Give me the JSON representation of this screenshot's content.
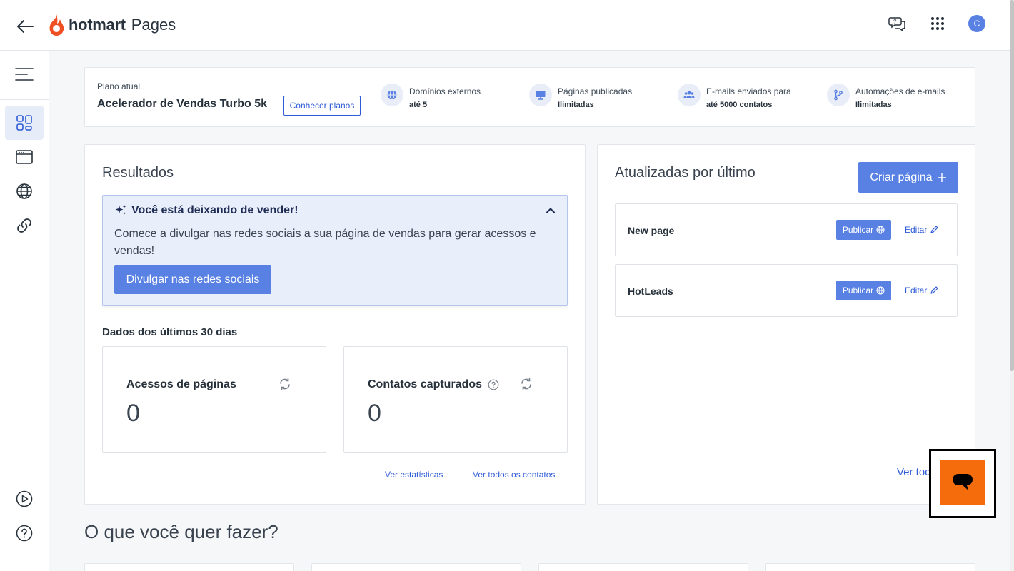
{
  "header": {
    "brand": "hotmart",
    "product": "Pages",
    "avatar_initial": "C",
    "icons": [
      "back-arrow-icon",
      "chat-help-icon",
      "apps-grid-icon"
    ]
  },
  "sidebar": {
    "items": [
      {
        "name": "dashboard",
        "icon": "dashboard-grid-icon",
        "active": true
      },
      {
        "name": "pages",
        "icon": "browser-window-icon",
        "active": false
      },
      {
        "name": "domains",
        "icon": "globe-icon",
        "active": false
      },
      {
        "name": "links",
        "icon": "link-icon",
        "active": false
      }
    ],
    "bottom": [
      "play-circle-icon",
      "help-circle-icon"
    ]
  },
  "plan": {
    "label": "Plano atual",
    "name": "Acelerador de Vendas Turbo 5k",
    "button": "Conhecer planos",
    "features": [
      {
        "title": "Domínios externos",
        "value": "até 5",
        "icon": "globe-icon"
      },
      {
        "title": "Páginas publicadas",
        "value": "Ilimitadas",
        "icon": "monitor-icon"
      },
      {
        "title": "E-mails enviados para",
        "value": "até 5000 contatos",
        "icon": "users-icon"
      },
      {
        "title": "Automações de e-mails",
        "value": "Ilimitadas",
        "icon": "branch-icon"
      }
    ]
  },
  "results": {
    "title": "Resultados",
    "alert": {
      "title": "Você está deixando de vender!",
      "text": "Comece a divulgar nas redes sociais a sua página de vendas para gerar acessos e vendas!",
      "button": "Divulgar nas redes sociais"
    },
    "subtitle": "Dados dos últimos 30 dias",
    "metrics": [
      {
        "label": "Acessos de páginas",
        "value": "0"
      },
      {
        "label": "Contatos capturados",
        "value": "0"
      }
    ],
    "links": {
      "stats": "Ver estatísticas",
      "contacts": "Ver todos os contatos"
    }
  },
  "updated": {
    "title": "Atualizadas por último",
    "create_button": "Criar página",
    "pages": [
      {
        "name": "New page",
        "publish": "Publicar",
        "edit": "Editar"
      },
      {
        "name": "HotLeads",
        "publish": "Publicar",
        "edit": "Editar"
      }
    ],
    "see_all": "Ver todas"
  },
  "section": {
    "title": "O que você quer fazer?"
  },
  "colors": {
    "accent": "#5981e3",
    "link": "#2e5bd6",
    "brand": "#f04e23",
    "chat": "#f46c0b"
  }
}
